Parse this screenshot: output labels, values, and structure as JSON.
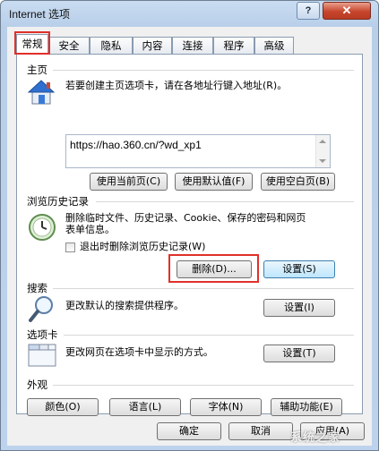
{
  "window": {
    "title": "Internet 选项",
    "help_label": "?",
    "close_label": "✕"
  },
  "tabs": [
    {
      "label": "常规"
    },
    {
      "label": "安全"
    },
    {
      "label": "隐私"
    },
    {
      "label": "内容"
    },
    {
      "label": "连接"
    },
    {
      "label": "程序"
    },
    {
      "label": "高级"
    }
  ],
  "home": {
    "heading": "主页",
    "description": "若要创建主页选项卡，请在各地址行键入地址(R)。",
    "url": "https://hao.360.cn/?wd_xp1",
    "buttons": [
      "使用当前页(C)",
      "使用默认值(F)",
      "使用空白页(B)"
    ]
  },
  "history": {
    "heading": "浏览历史记录",
    "description_line1": "删除临时文件、历史记录、Cookie、保存的密码和网页",
    "description_line2": "表单信息。",
    "checkbox_label": "退出时删除浏览历史记录(W)",
    "checkbox_checked": false,
    "delete_label": "删除(D)...",
    "settings_label": "设置(S)"
  },
  "search": {
    "heading": "搜索",
    "description": "更改默认的搜索提供程序。",
    "settings_label": "设置(I)"
  },
  "tabs_section": {
    "heading": "选项卡",
    "description": "更改网页在选项卡中显示的方式。",
    "settings_label": "设置(T)"
  },
  "appearance": {
    "heading": "外观",
    "buttons": [
      "颜色(O)",
      "语言(L)",
      "字体(N)",
      "辅助功能(E)"
    ]
  },
  "footer": {
    "ok_label": "确定",
    "cancel_label": "取消",
    "apply_label": "应用(A)"
  },
  "watermark": "系统之家"
}
